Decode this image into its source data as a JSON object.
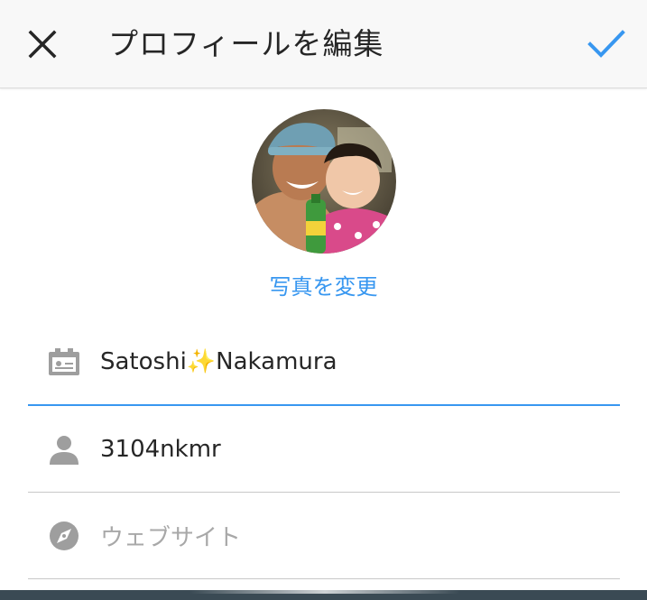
{
  "header": {
    "title": "プロフィールを編集",
    "close_icon": "close-icon",
    "done_icon": "checkmark-icon",
    "accent_color": "#3897f0"
  },
  "profile": {
    "avatar_alt": "profile-photo",
    "change_photo_label": "写真を変更"
  },
  "fields": {
    "name": {
      "icon": "id-card-icon",
      "value": "Satoshi✨Nakamura"
    },
    "username": {
      "icon": "person-icon",
      "value": "3104nkmr"
    },
    "website": {
      "icon": "compass-icon",
      "placeholder": "ウェブサイト"
    }
  }
}
